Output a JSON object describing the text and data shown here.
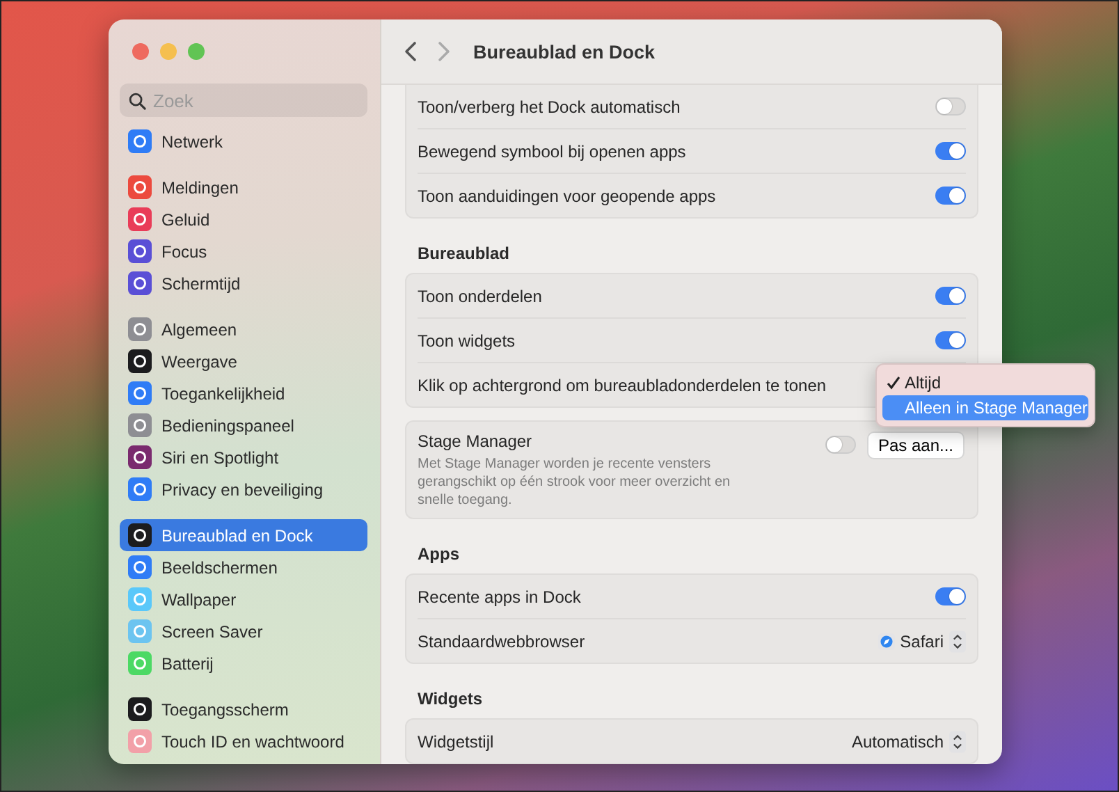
{
  "window": {
    "title": "Bureaublad en Dock"
  },
  "sidebar": {
    "search": {
      "placeholder": "Zoek"
    },
    "groups": [
      [
        {
          "label": "Netwerk",
          "color": "#2f7cf6",
          "selected": false
        }
      ],
      [
        {
          "label": "Meldingen",
          "color": "#ec4a3e",
          "selected": false
        },
        {
          "label": "Geluid",
          "color": "#e93c58",
          "selected": false
        },
        {
          "label": "Focus",
          "color": "#5a4fd6",
          "selected": false
        },
        {
          "label": "Schermtijd",
          "color": "#5a4fd6",
          "selected": false
        }
      ],
      [
        {
          "label": "Algemeen",
          "color": "#8e8e93",
          "selected": false
        },
        {
          "label": "Weergave",
          "color": "#1c1c1e",
          "selected": false
        },
        {
          "label": "Toegankelijkheid",
          "color": "#2f7cf6",
          "selected": false
        },
        {
          "label": "Bedieningspaneel",
          "color": "#8e8e93",
          "selected": false
        },
        {
          "label": "Siri en Spotlight",
          "color": "#7a2a6e",
          "selected": false
        },
        {
          "label": "Privacy en beveiliging",
          "color": "#2f7cf6",
          "selected": false
        }
      ],
      [
        {
          "label": "Bureaublad en Dock",
          "color": "#1c1c1e",
          "selected": true
        },
        {
          "label": "Beeldschermen",
          "color": "#2f7cf6",
          "selected": false
        },
        {
          "label": "Wallpaper",
          "color": "#5ac8fa",
          "selected": false
        },
        {
          "label": "Screen Saver",
          "color": "#6cc4f0",
          "selected": false
        },
        {
          "label": "Batterij",
          "color": "#4cd964",
          "selected": false
        }
      ],
      [
        {
          "label": "Toegangsscherm",
          "color": "#1c1c1e",
          "selected": false
        },
        {
          "label": "Touch ID en wachtwoord",
          "color": "#f2a0a8",
          "selected": false
        }
      ]
    ]
  },
  "sections": [
    {
      "cards": [
        [
          {
            "kind": "toggle",
            "label": "Toon/verberg het Dock automatisch",
            "on": false
          },
          {
            "kind": "toggle",
            "label": "Bewegend symbool bij openen apps",
            "on": true
          },
          {
            "kind": "toggle",
            "label": "Toon aanduidingen voor geopende apps",
            "on": true
          }
        ]
      ]
    },
    {
      "heading": "Bureaublad",
      "cards": [
        [
          {
            "kind": "toggle",
            "label": "Toon onderdelen",
            "on": true
          },
          {
            "kind": "toggle",
            "label": "Toon widgets",
            "on": true
          },
          {
            "kind": "menu",
            "label": "Klik op achtergrond om bureaubladonderdelen te tonen",
            "menu": [
              {
                "label": "Altijd",
                "selected": true,
                "highlighted": false
              },
              {
                "label": "Alleen in Stage Manager",
                "selected": false,
                "highlighted": true
              }
            ]
          }
        ],
        [
          {
            "kind": "stage",
            "label": "Stage Manager",
            "description": "Met Stage Manager worden je recente vensters gerangschikt op één strook voor meer overzicht en snelle toegang.",
            "on": false,
            "button": "Pas aan..."
          }
        ]
      ]
    },
    {
      "heading": "Apps",
      "cards": [
        [
          {
            "kind": "toggle",
            "label": "Recente apps in Dock",
            "on": true
          },
          {
            "kind": "select",
            "label": "Standaardwebbrowser",
            "value": "Safari",
            "app_icon": true
          }
        ]
      ]
    },
    {
      "heading": "Widgets",
      "cards": [
        [
          {
            "kind": "select",
            "label": "Widgetstijl",
            "value": "Automatisch",
            "app_icon": false
          }
        ]
      ]
    }
  ]
}
